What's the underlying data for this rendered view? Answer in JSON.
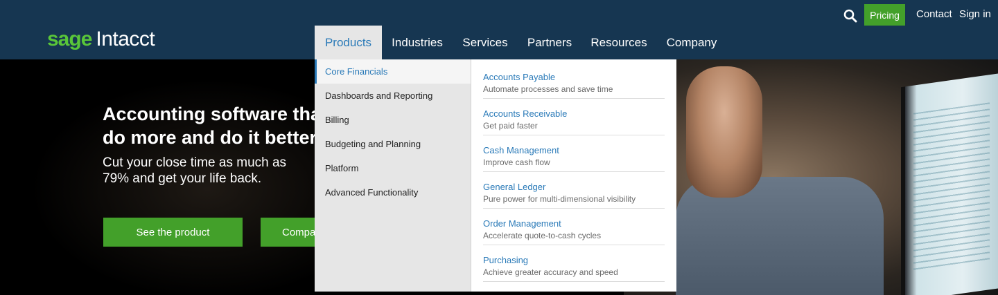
{
  "brand": {
    "logo_primary": "sage",
    "logo_secondary": "Intacct",
    "accent_green": "#43a02a",
    "header_bg": "#163651",
    "link_blue": "#2a7ab8"
  },
  "utility_nav": {
    "search_icon": "search-icon",
    "pricing": "Pricing",
    "contact": "Contact",
    "signin": "Sign in"
  },
  "main_nav": {
    "products": "Products",
    "industries": "Industries",
    "services": "Services",
    "partners": "Partners",
    "resources": "Resources",
    "company": "Company"
  },
  "hero": {
    "title_line1": "Accounting software that",
    "title_line2": "do more and do it better",
    "subtitle": "Cut your close time as much as 79% and get your life back.",
    "primary_button": "See the product",
    "secondary_button": "Compar"
  },
  "products_menu": {
    "categories": [
      {
        "label": "Core Financials",
        "active": true
      },
      {
        "label": "Dashboards and Reporting"
      },
      {
        "label": "Billing"
      },
      {
        "label": "Budgeting and Planning"
      },
      {
        "label": "Platform"
      },
      {
        "label": "Advanced Functionality"
      }
    ],
    "items": [
      {
        "title": "Accounts Payable",
        "desc": "Automate processes and save time"
      },
      {
        "title": "Accounts Receivable",
        "desc": "Get paid faster"
      },
      {
        "title": "Cash Management",
        "desc": "Improve cash flow"
      },
      {
        "title": "General Ledger",
        "desc": "Pure power for multi-dimensional visibility"
      },
      {
        "title": "Order Management",
        "desc": "Accelerate quote-to-cash cycles"
      },
      {
        "title": "Purchasing",
        "desc": "Achieve greater accuracy and speed"
      }
    ]
  }
}
